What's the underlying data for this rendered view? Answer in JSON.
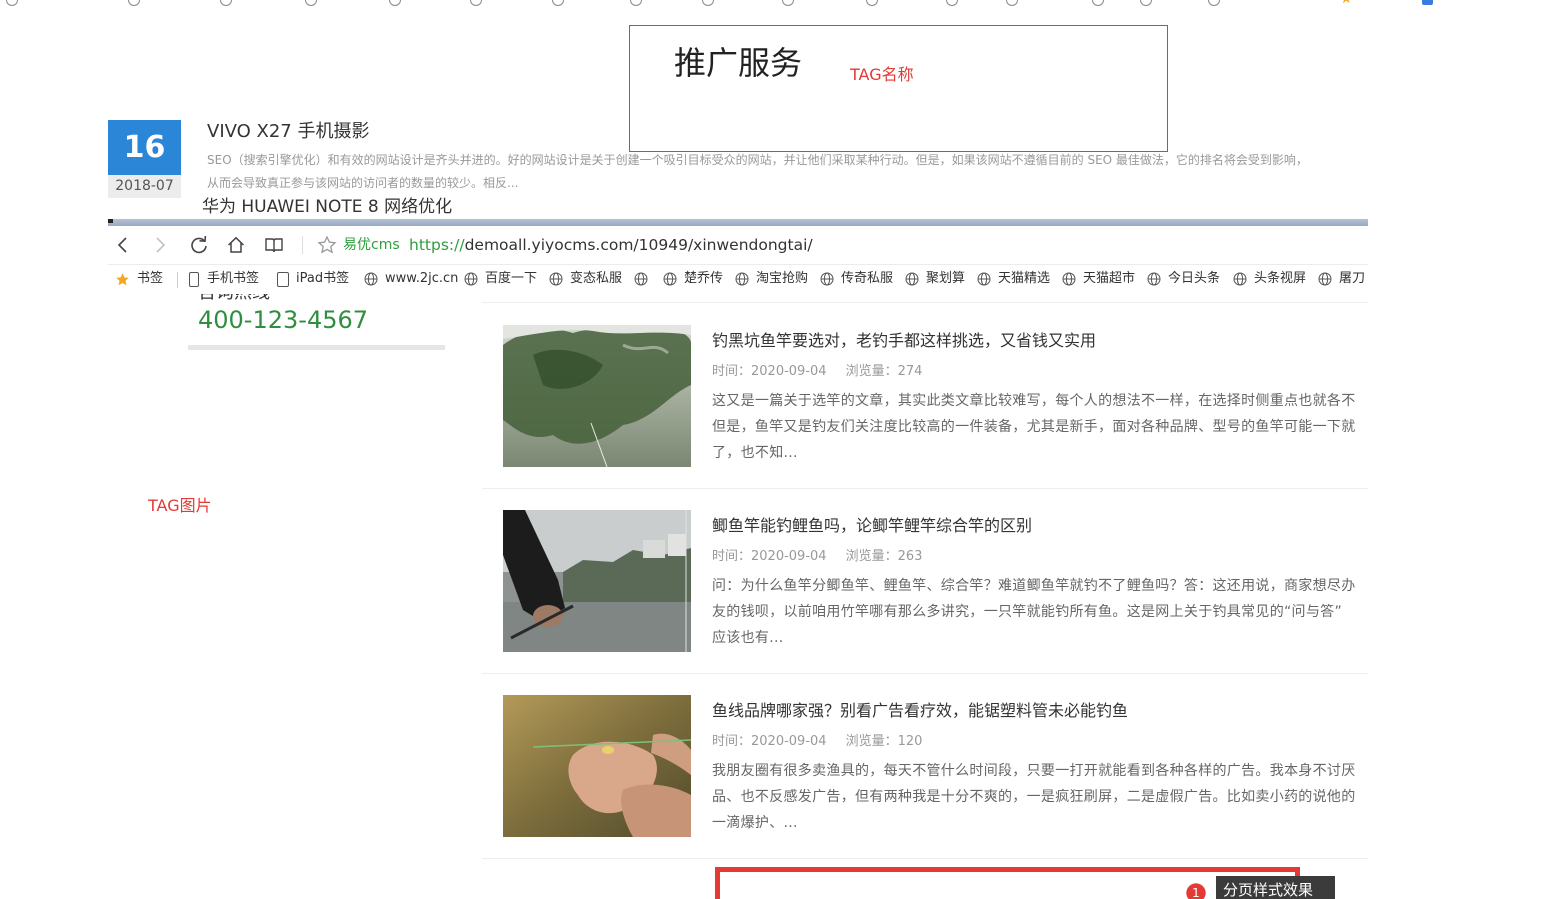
{
  "annotations": {
    "tag_name_label": "TAG名称",
    "tag_image_label": "TAG图片",
    "pagination_badge": "1",
    "pagination_tooltip": "分页样式效果"
  },
  "tag_box": {
    "title": "推广服务"
  },
  "featured_article": {
    "day": "16",
    "month": "2018-07",
    "title": "VIVO X27 手机摄影",
    "description_lines": [
      "SEO（搜索引擎优化）和有效的网站设计是齐头并进的。好的网站设计是关于创建一个吸引目标受众的网站，并让他们采取某种行动。但是，如果该网站不遵循目前的 SEO 最佳做法，它的排名将会受到影响，",
      "从而会导致真正参与该网站的访问者的数量的较少。相反..."
    ]
  },
  "next_article_title": "华为 HUAWEI NOTE 8 网络优化",
  "browser": {
    "site_name": "易优cms",
    "url_scheme": "https://",
    "url_rest": "demoall.yiyocms.com/10949/xinwendongtai/",
    "bookmarks": [
      {
        "icon": "star-icon",
        "label": "书签"
      },
      {
        "icon": "phone-icon",
        "label": "手机书签"
      },
      {
        "icon": "tablet-icon",
        "label": "iPad书签"
      },
      {
        "icon": "globe-icon",
        "label": "www.2jc.cn"
      },
      {
        "icon": "globe-icon",
        "label": "百度一下"
      },
      {
        "icon": "globe-icon",
        "label": "变态私服"
      },
      {
        "icon": "globe-icon"
      },
      {
        "icon": "globe-icon",
        "label": "楚乔传"
      },
      {
        "icon": "globe-icon",
        "label": "淘宝抢购"
      },
      {
        "icon": "globe-icon",
        "label": "传奇私服"
      },
      {
        "icon": "globe-icon",
        "label": "聚划算"
      },
      {
        "icon": "globe-icon",
        "label": "天猫精选"
      },
      {
        "icon": "globe-icon",
        "label": "天猫超市"
      },
      {
        "icon": "globe-icon",
        "label": "今日头条"
      },
      {
        "icon": "globe-icon",
        "label": "头条视屏"
      },
      {
        "icon": "globe-icon",
        "label": "屠刀"
      }
    ]
  },
  "sidebar": {
    "hotline_label": "咨询热线",
    "phone": "400-123-4567"
  },
  "articles": [
    {
      "title": "钓黑坑鱼竿要选对，老钓手都这样挑选，又省钱又实用",
      "time": "时间：2020-09-04",
      "views": "浏览量：274",
      "summary_lines": [
        "这又是一篇关于选竿的文章，其实此类文章比较难写，每个人的想法不一样，在选择时侧重点也就各不",
        "但是，鱼竿又是钓友们关注度比较高的一件装备，尤其是新手，面对各种品牌、型号的鱼竿可能一下就",
        "了，也不知..."
      ]
    },
    {
      "title": "鲫鱼竿能钓鲤鱼吗，论鲫竿鲤竿综合竿的区别",
      "time": "时间：2020-09-04",
      "views": "浏览量：263",
      "summary_lines": [
        "问：为什么鱼竿分鲫鱼竿、鲤鱼竿、综合竿？难道鲫鱼竿就钓不了鲤鱼吗？答：这还用说，商家想尽办",
        "友的钱呗，以前咱用竹竿哪有那么多讲究，一只竿就能钓所有鱼。这是网上关于钓具常见的“问与答”",
        "应该也有..."
      ]
    },
    {
      "title": "鱼线品牌哪家强？别看广告看疗效，能锯塑料管未必能钓鱼",
      "time": "时间：2020-09-04",
      "views": "浏览量：120",
      "summary_lines": [
        "我朋友圈有很多卖渔具的，每天不管什么时间段，只要一打开就能看到各种各样的广告。我本身不讨厌",
        "品、也不反感发广告，但有两种我是十分不爽的，一是疯狂刷屏，二是虚假广告。比如卖小药的说他的",
        "一滴爆护、..."
      ]
    }
  ],
  "colors": {
    "annotation_red": "#e53935",
    "date_badge_blue": "#2c86d8",
    "hotline_green": "#2f8f3f",
    "url_green": "#2e9e3e",
    "bookmark_star_orange": "#f5a623"
  }
}
